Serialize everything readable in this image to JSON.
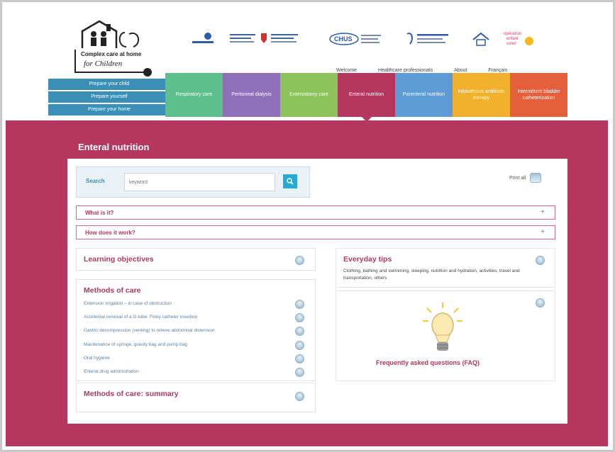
{
  "brand": {
    "line1": "Complex care at home",
    "line2": "for Children"
  },
  "partners": [
    "CHU Sainte-Justine",
    "Hôpital de Montréal pour enfants",
    "CHUS",
    "CIUSSS",
    "Opération Enfant Soleil"
  ],
  "topnav": [
    "Welcome",
    "Healthcare professionals",
    "About",
    "Français"
  ],
  "leftnav": [
    "Prepare your child",
    "Prepare yourself",
    "Prepare your home"
  ],
  "tabs": [
    {
      "label": "Respiratory care",
      "color": "#5cbf8c"
    },
    {
      "label": "Peritoneal dialysis",
      "color": "#8f6fb9"
    },
    {
      "label": "Enterostomy care",
      "color": "#8dc35a"
    },
    {
      "label": "Enteral nutrition",
      "color": "#b5365f"
    },
    {
      "label": "Parenteral nutrition",
      "color": "#5f9bd6"
    },
    {
      "label": "Intravenous antibiotic therapy",
      "color": "#f3b02d"
    },
    {
      "label": "Intermittent bladder catheterization",
      "color": "#e55f3b"
    }
  ],
  "page": {
    "title": "Enteral nutrition",
    "print_all": "Print all"
  },
  "search": {
    "label": "Search",
    "placeholder": "keyword"
  },
  "accordions": [
    "What is it?",
    "How does it work?"
  ],
  "learning": {
    "title": "Learning objectives"
  },
  "methods": {
    "title": "Methods of care",
    "items": [
      "Extension irrigation – in case of obstruction",
      "Accidental removal of a G-tube: Foley catheter insertion",
      "Gastric decompression (venting) to relieve abdominal distension",
      "Maintenance of syringe, gravity bag and pump bag",
      "Oral hygiene",
      "Enteral drug administration"
    ]
  },
  "summary": {
    "title": "Methods of care: summary"
  },
  "tips": {
    "title": "Everyday tips",
    "text": "Clothing, bathing and swimming, sleeping, nutrition and hydration, activities, travel and transportation, others"
  },
  "faq": {
    "title": "Frequently asked questions (FAQ)"
  }
}
